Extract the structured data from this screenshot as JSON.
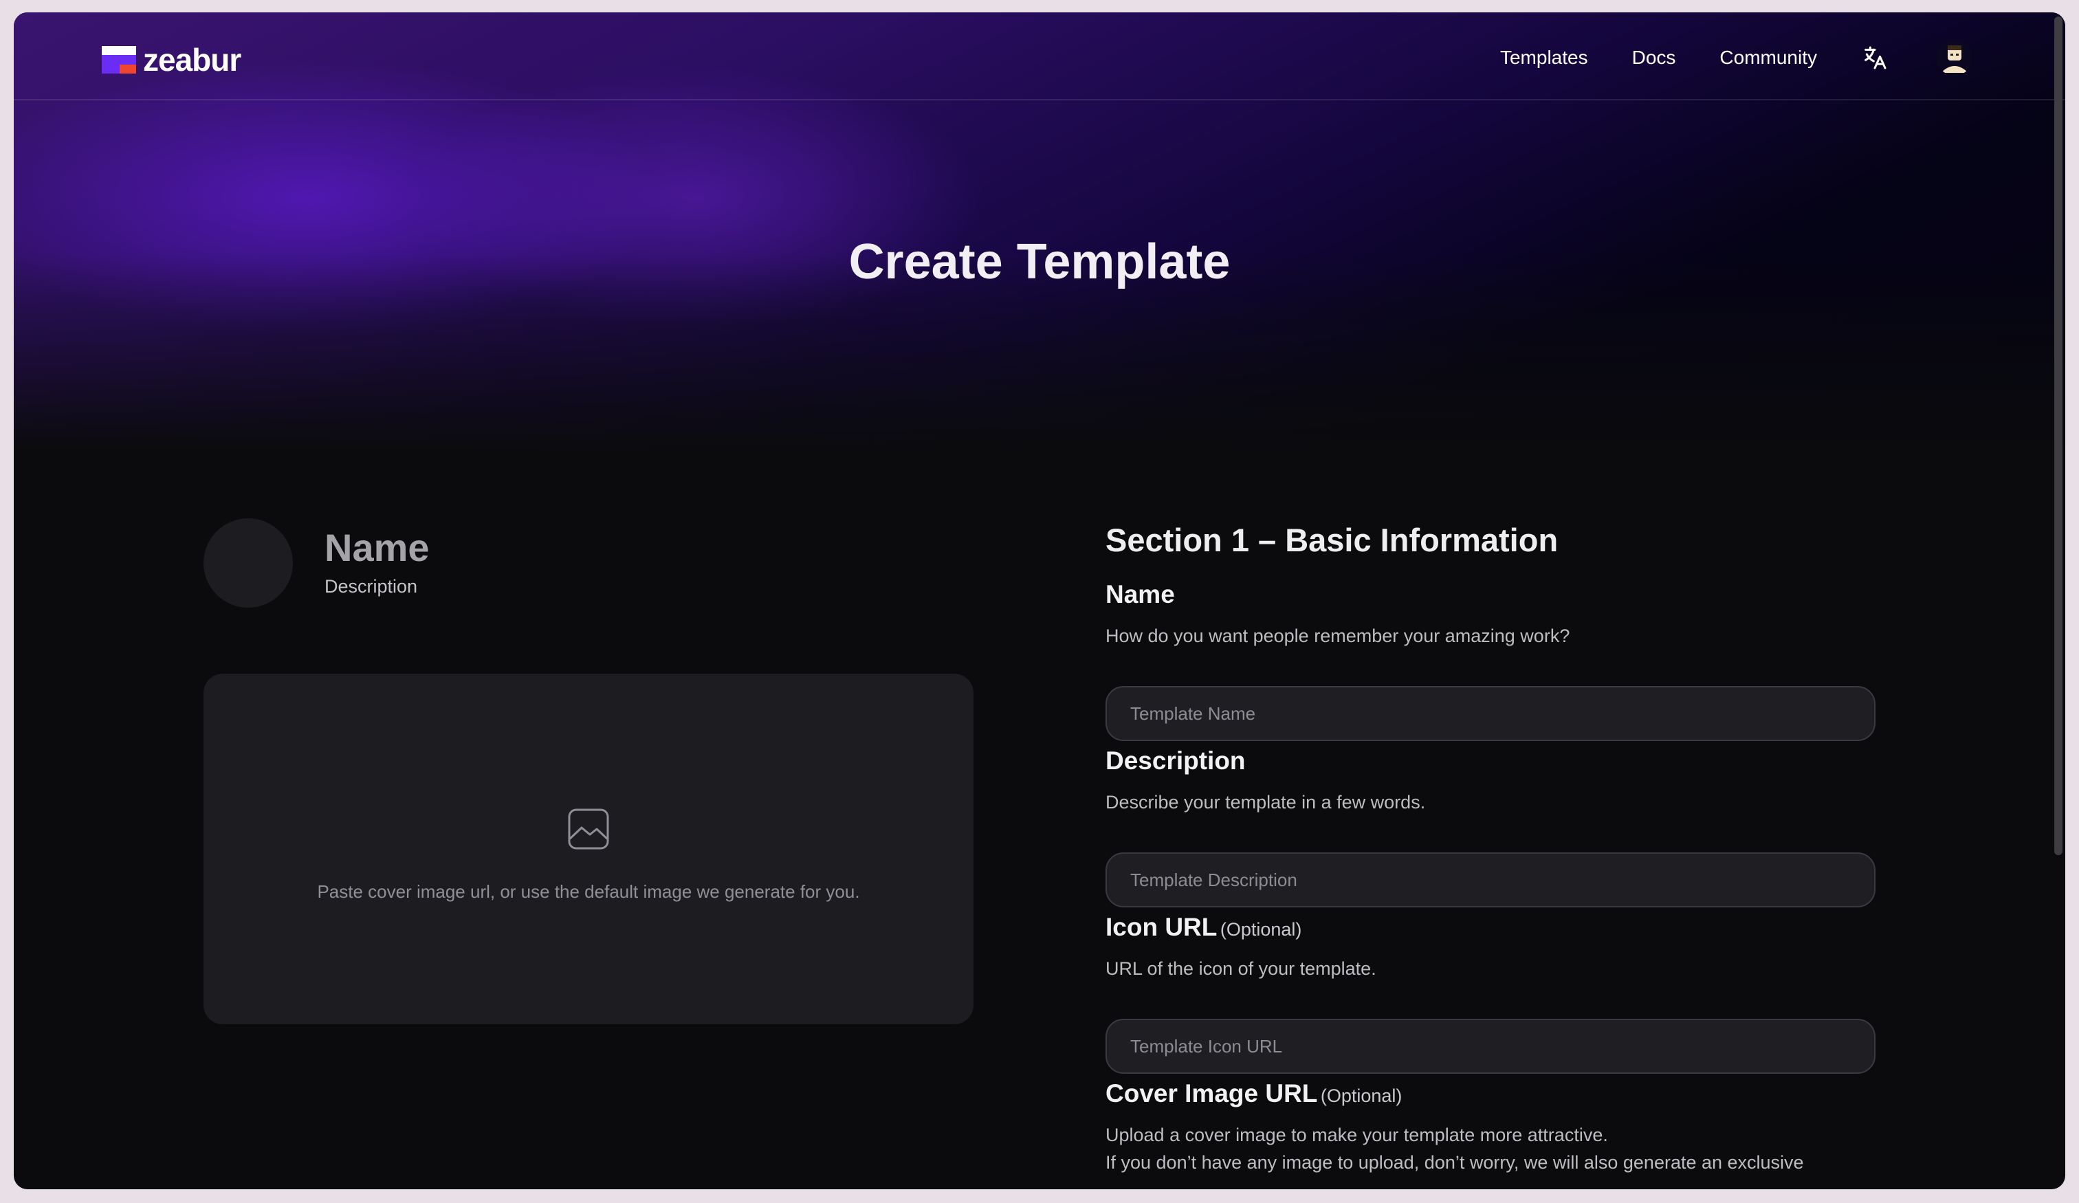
{
  "nav": {
    "logo_text": "zeabur",
    "links": [
      "Templates",
      "Docs",
      "Community"
    ]
  },
  "page_title": "Create Template",
  "preview": {
    "name": "Name",
    "description": "Description",
    "cover_hint": "Paste cover image url, or use the default image we generate for you."
  },
  "form": {
    "section_title": "Section 1 – Basic Information",
    "name": {
      "label": "Name",
      "help": "How do you want people remember your amazing work?",
      "placeholder": "Template Name"
    },
    "description": {
      "label": "Description",
      "help": "Describe your template in a few words.",
      "placeholder": "Template Description"
    },
    "icon_url": {
      "label": "Icon URL",
      "optional": "(Optional)",
      "help": "URL of the icon of your template.",
      "placeholder": "Template Icon URL"
    },
    "cover_image_url": {
      "label": "Cover Image URL",
      "optional": "(Optional)",
      "help_line1": "Upload a cover image to make your template more attractive.",
      "help_line2": "If you don’t have any image to upload, don’t worry, we will also generate an exclusive"
    }
  },
  "icons": [
    "zeabur-logo-icon",
    "translate-icon",
    "avatar",
    "image-placeholder-icon"
  ],
  "colors": {
    "accent_purple": "#5a1cc0",
    "background": "#0b0b0d",
    "input_bg": "#1f1e23"
  }
}
